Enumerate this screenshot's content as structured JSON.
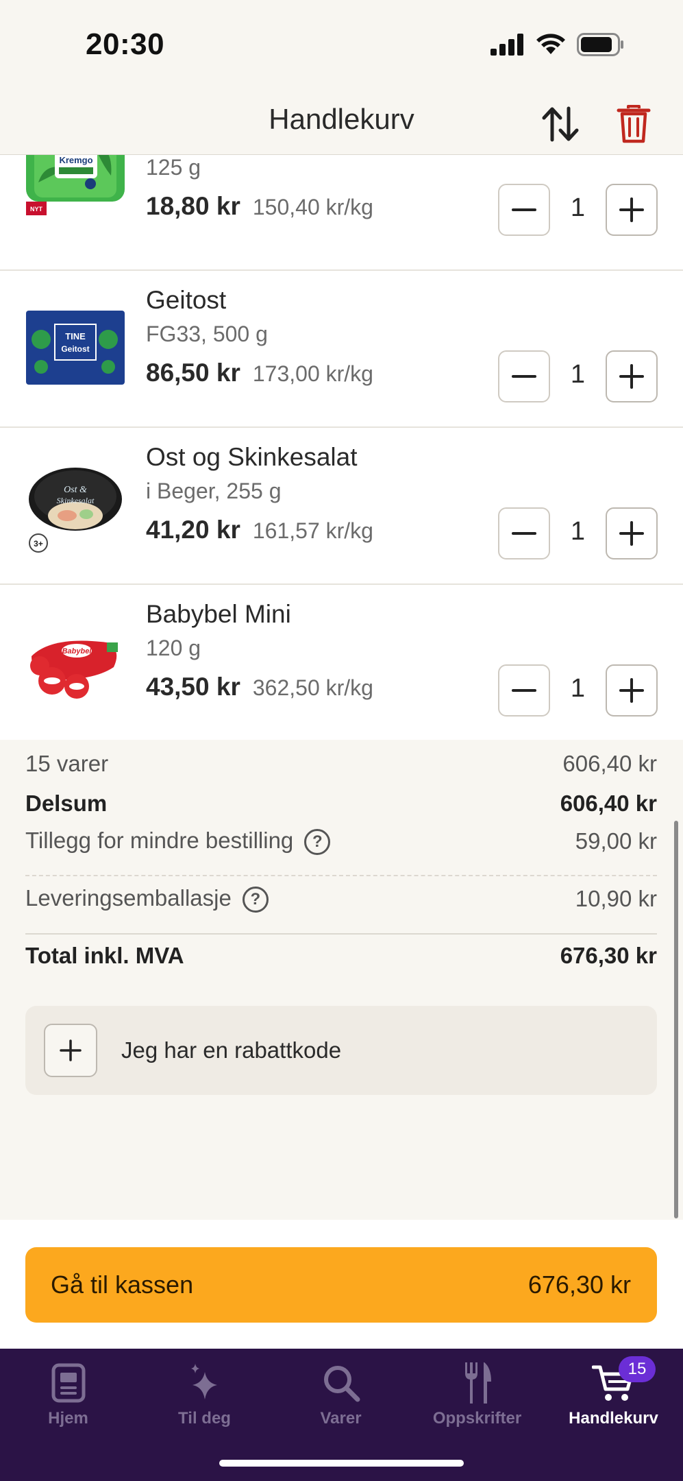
{
  "status_bar": {
    "time": "20:30"
  },
  "header": {
    "title": "Handlekurv"
  },
  "items": [
    {
      "name": "",
      "desc": "125 g",
      "price": "18,80 kr",
      "unit_price": "150,40 kr/kg",
      "qty": "1",
      "image": "TINE Kremgo urter",
      "badge": "NYT NORGE"
    },
    {
      "name": "Geitost",
      "desc": "FG33, 500 g",
      "price": "86,50 kr",
      "unit_price": "173,00 kr/kg",
      "qty": "1",
      "image": "TINE Geitost"
    },
    {
      "name": "Ost og Skinkesalat",
      "desc": "i Beger, 255 g",
      "price": "41,20 kr",
      "unit_price": "161,57 kr/kg",
      "qty": "1",
      "image": "Ost & Skinkesalat",
      "badge": "3+"
    },
    {
      "name": "Babybel Mini",
      "desc": "120 g",
      "price": "43,50 kr",
      "unit_price": "362,50 kr/kg",
      "qty": "1",
      "image": "Babybel"
    }
  ],
  "summary": {
    "items_label": "15 varer",
    "items_value": "606,40 kr",
    "subtotal_label": "Delsum",
    "subtotal_value": "606,40 kr",
    "small_order_label": "Tillegg for mindre bestilling",
    "small_order_value": "59,00 kr",
    "packaging_label": "Leveringsemballasje",
    "packaging_value": "10,90 kr",
    "total_label": "Total inkl. MVA",
    "total_value": "676,30 kr",
    "help_glyph": "?"
  },
  "promo": {
    "label": "Jeg har en rabattkode"
  },
  "checkout": {
    "label": "Gå til kassen",
    "total": "676,30 kr"
  },
  "tabs": [
    {
      "label": "Hjem",
      "icon": "home-icon"
    },
    {
      "label": "Til deg",
      "icon": "sparkle-icon"
    },
    {
      "label": "Varer",
      "icon": "search-icon"
    },
    {
      "label": "Oppskrifter",
      "icon": "fork-knife-icon"
    },
    {
      "label": "Handlekurv",
      "icon": "cart-icon",
      "active": true,
      "badge": "15"
    }
  ],
  "colors": {
    "accent": "#fca81e",
    "tabbar": "#2b1346",
    "badge": "#6b2ed6",
    "trash": "#c0281f"
  }
}
